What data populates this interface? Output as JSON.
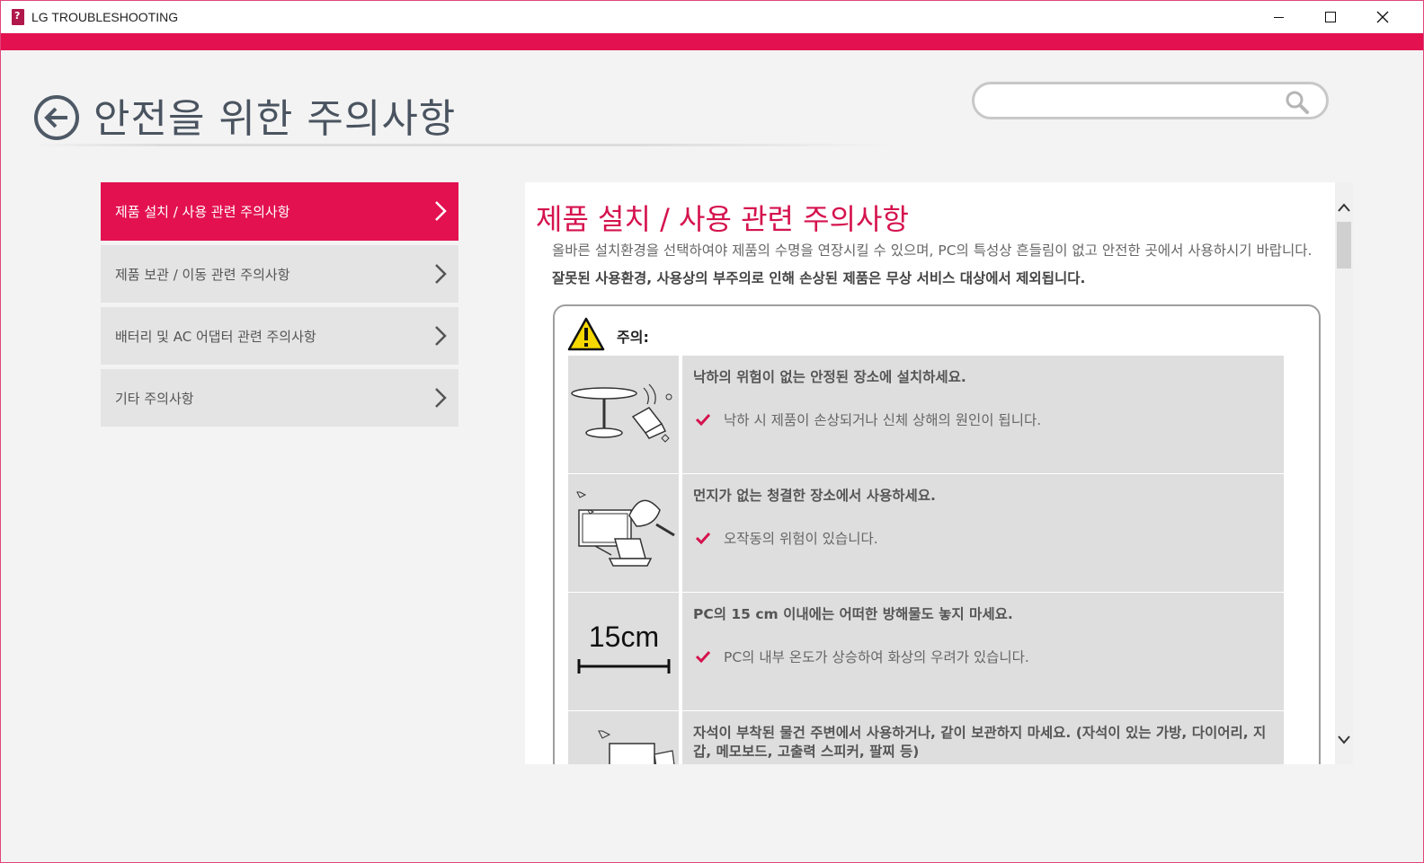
{
  "window": {
    "title": "LG TROUBLESHOOTING"
  },
  "colors": {
    "accent": "#e31150",
    "title_text": "#4a5460"
  },
  "header": {
    "page_title": "안전을 위한 주의사항",
    "search_placeholder": ""
  },
  "sidebar": {
    "items": [
      {
        "label": "제품 설치 / 사용 관련 주의사항",
        "active": true
      },
      {
        "label": "제품 보관 / 이동 관련 주의사항",
        "active": false
      },
      {
        "label": "배터리 및 AC 어댑터 관련 주의사항",
        "active": false
      },
      {
        "label": "기타 주의사항",
        "active": false
      }
    ]
  },
  "content": {
    "title": "제품 설치 / 사용 관련 주의사항",
    "intro1": "올바른 설치환경을 선택하여야 제품의 수명을 연장시킬 수 있으며, PC의 특성상 흔들림이 없고 안전한 곳에서 사용하시기 바랍니다.",
    "intro2": "잘못된 사용환경, 사용상의 부주의로 인해 손상된 제품은 무상 서비스 대상에서 제외됩니다.",
    "caution_label": "주의:",
    "rows": [
      {
        "icon": "falling-laptop-icon",
        "headline": "낙하의 위험이 없는 안정된 장소에 설치하세요.",
        "bullet": "낙하 시 제품이 손상되거나 신체 상해의 원인이 됩니다."
      },
      {
        "icon": "dust-cleaning-icon",
        "headline": "먼지가 없는 청결한 장소에서 사용하세요.",
        "bullet": "오작동의 위험이 있습니다."
      },
      {
        "icon": "distance-15cm-icon",
        "icon_text": "15cm",
        "headline": "PC의 15 cm 이내에는 어떠한 방해물도 놓지 마세요.",
        "bullet": "PC의 내부 온도가 상승하여 화상의 우려가 있습니다."
      },
      {
        "icon": "magnet-device-icon",
        "headline": "자석이 부착된 물건 주변에서 사용하거나, 같이 보관하지 마세요. (자석이 있는 가방, 다이어리, 지갑, 메모보드, 고출력 스피커, 팔찌 등)",
        "bullet": ""
      }
    ]
  }
}
